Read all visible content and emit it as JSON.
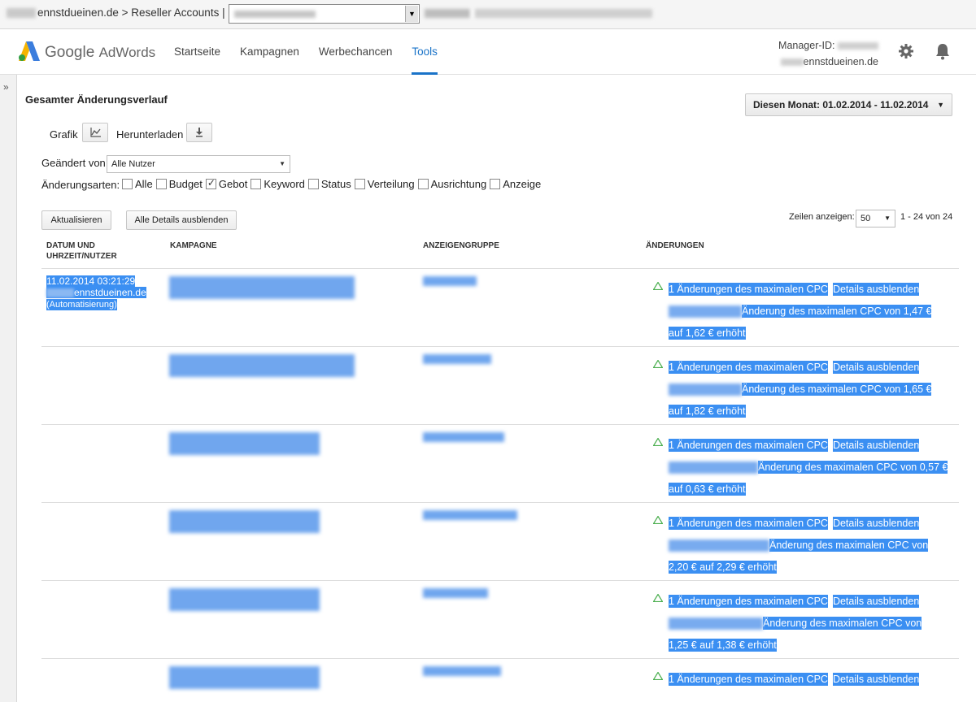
{
  "topbar": {
    "email_domain": "ennstdueinen.de",
    "path_separator": ">",
    "section": "Reseller Accounts",
    "pipe": "|"
  },
  "nav": {
    "logo_google": "Google",
    "logo_product": "AdWords",
    "items": [
      "Startseite",
      "Kampagnen",
      "Werbechancen",
      "Tools"
    ],
    "active": "Tools",
    "manager_label": "Manager-ID:",
    "user_email_domain": "ennstdueinen.de"
  },
  "page": {
    "title": "Gesamter Änderungsverlauf",
    "date_range": "Diesen Monat: 01.02.2014 - 11.02.2014",
    "graph_label": "Grafik",
    "download_label": "Herunterladen",
    "changed_by_label": "Geändert von",
    "changed_by_value": "Alle Nutzer",
    "change_types_label": "Änderungsarten:",
    "change_types": [
      {
        "label": "Alle",
        "checked": false
      },
      {
        "label": "Budget",
        "checked": false
      },
      {
        "label": "Gebot",
        "checked": true
      },
      {
        "label": "Keyword",
        "checked": false
      },
      {
        "label": "Status",
        "checked": false
      },
      {
        "label": "Verteilung",
        "checked": false
      },
      {
        "label": "Ausrichtung",
        "checked": false
      },
      {
        "label": "Anzeige",
        "checked": false
      }
    ],
    "refresh_button": "Aktualisieren",
    "hide_details_button": "Alle Details ausblenden",
    "rows_label": "Zeilen anzeigen:",
    "rows_value": "50",
    "pager": "1 - 24 von 24"
  },
  "table": {
    "headers": {
      "date_line1": "DATUM UND",
      "date_line2": "UHRZEIT/NUTZER",
      "campaign": "KAMPAGNE",
      "adgroup": "ANZEIGENGRUPPE",
      "changes": "ÄNDERUNGEN"
    },
    "first_row": {
      "datetime": "11.02.2014 03:21:29",
      "user_domain": "ennstdueinen.de",
      "source": "(Automatisierung)"
    },
    "rows": [
      {
        "summary": "1 Änderungen des maximalen CPC",
        "details_link": "Details ausblenden",
        "line2": "Änderung des maximalen CPC von 1,47 €",
        "line3": "auf 1,62 € erhöht"
      },
      {
        "summary": "1 Änderungen des maximalen CPC",
        "details_link": "Details ausblenden",
        "line2": "Änderung des maximalen CPC von 1,65 €",
        "line3": "auf 1,82 € erhöht"
      },
      {
        "summary": "1 Änderungen des maximalen CPC",
        "details_link": "Details ausblenden",
        "line2": "Änderung des maximalen CPC von 0,57 €",
        "line3": "auf 0,63 € erhöht"
      },
      {
        "summary": "1 Änderungen des maximalen CPC",
        "details_link": "Details ausblenden",
        "line2": "Änderung des maximalen CPC von",
        "line3": "2,20 € auf 2,29 € erhöht"
      },
      {
        "summary": "1 Änderungen des maximalen CPC",
        "details_link": "Details ausblenden",
        "line2": "Änderung des maximalen CPC von",
        "line3": "1,25 € auf 1,38 € erhöht"
      },
      {
        "summary": "1 Änderungen des maximalen CPC",
        "details_link": "Details ausblenden",
        "line2": "",
        "line3": ""
      }
    ]
  },
  "colors": {
    "selection": "#3b8ff2",
    "accent": "#1a73c8",
    "triangle": "#4caf50"
  },
  "icons": [
    "chart-icon",
    "download-icon",
    "gear-icon",
    "bell-icon",
    "triangle-up-icon",
    "chevron-double-right-icon"
  ]
}
